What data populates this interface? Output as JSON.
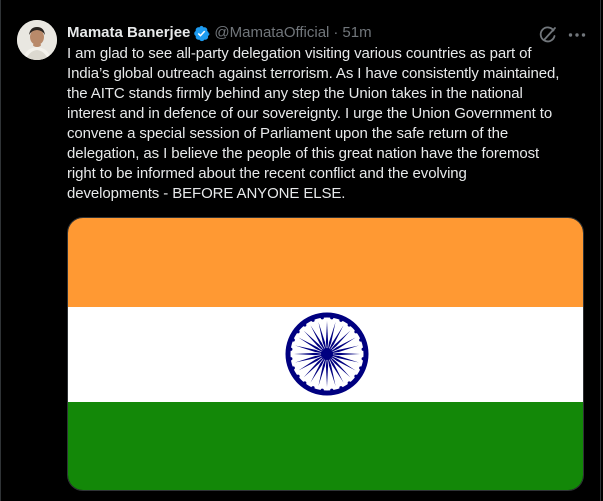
{
  "author": {
    "name": "Mamata Banerjee",
    "handle": "@MamataOfficial",
    "separator": "·",
    "time": "51m"
  },
  "actions": {
    "grok_icon": "grok-icon",
    "more_icon": "more-icon"
  },
  "tweet": {
    "lines": [
      "I am glad to see all-party delegation visiting various countries as part of",
      "India’s global outreach against terrorism. As I have consistently maintained,",
      "the AITC stands firmly behind any step the Union takes in the national",
      "interest and in defence of our sovereignty. I urge the Union Government to",
      "convene a special session of Parliament upon the safe return of the",
      "delegation, as I believe the people of this great nation have the foremost",
      "right to be informed about the recent conflict and the evolving",
      "developments - BEFORE ANYONE ELSE."
    ]
  },
  "media": {
    "type": "indian-flag",
    "colors": {
      "saffron": "#FF9933",
      "white": "#FFFFFF",
      "green": "#138808",
      "chakra": "#000080"
    }
  },
  "colors": {
    "background": "#000000",
    "text_primary": "#e7e9ea",
    "text_secondary": "#71767b",
    "verified_badge": "#1d9bf0",
    "border": "#2f3336"
  }
}
